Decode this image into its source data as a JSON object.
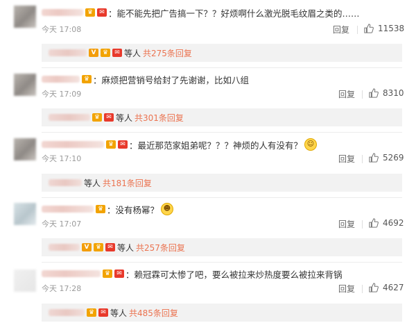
{
  "comments": [
    {
      "text": "：能不能先把广告搞一下？？好烦啊什么激光脱毛纹眉之类的……",
      "time": "今天 17:08",
      "reply": "回复",
      "likes": "11538",
      "sub": {
        "etal": "等人",
        "total": "共275条回复"
      }
    },
    {
      "text": "：麻烦把营销号给封了先谢谢，比如八组",
      "time": "今天 17:09",
      "reply": "回复",
      "likes": "8310",
      "sub": {
        "etal": "等人",
        "total": "共301条回复"
      }
    },
    {
      "text": "：最近那范家姐弟呢？？？神烦的人有没有？",
      "time": "今天 17:10",
      "reply": "回复",
      "likes": "5269",
      "sub": {
        "etal": "等人",
        "total": "共181条回复"
      }
    },
    {
      "text": "：没有杨幂？",
      "time": "今天 17:07",
      "reply": "回复",
      "likes": "4692",
      "sub": {
        "etal": "等人",
        "total": "共257条回复"
      }
    },
    {
      "text": "：赖冠霖可太惨了吧，要么被拉来炒热度要么被拉来背锅",
      "time": "今天 17:28",
      "reply": "回复",
      "likes": "4627",
      "sub": {
        "etal": "等人",
        "total": "共485条回复"
      }
    }
  ]
}
